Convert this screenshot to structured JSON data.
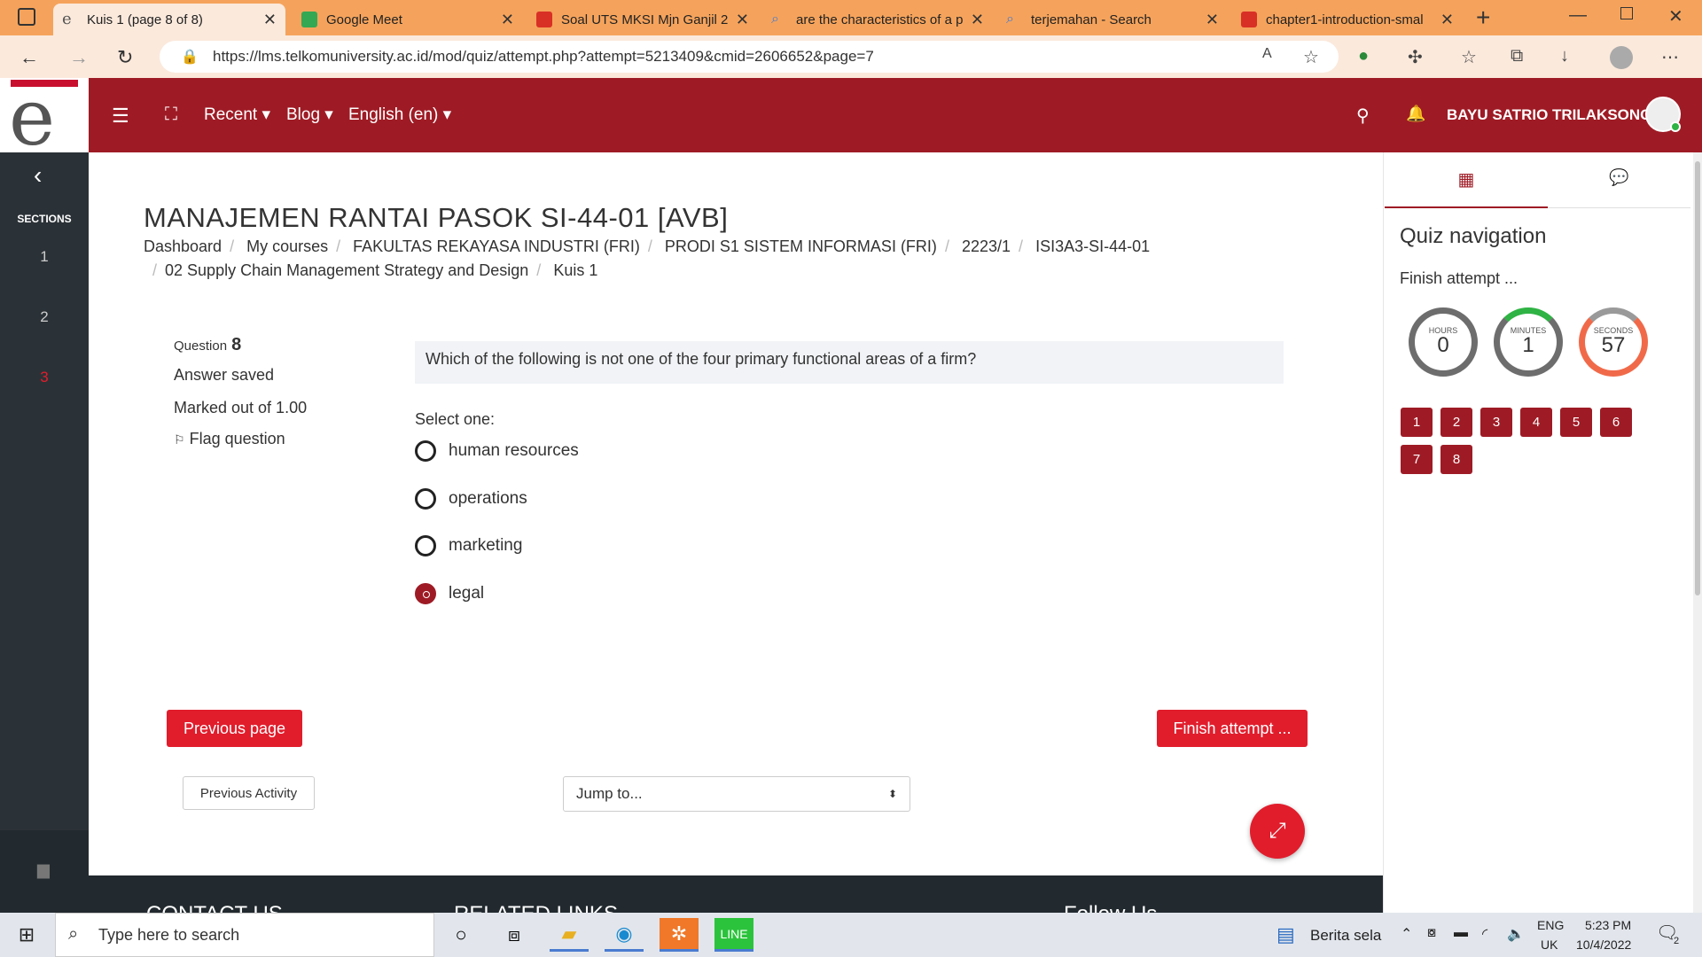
{
  "browser": {
    "tabs": [
      {
        "title": "Kuis 1 (page 8 of 8)",
        "active": true,
        "favicon_color": "#666666"
      },
      {
        "title": "Google Meet",
        "active": false,
        "favicon_color": "#34a853"
      },
      {
        "title": "Soal UTS MKSI Mjn Ganjil 2(",
        "active": false,
        "favicon_color": "#d93025"
      },
      {
        "title": "are the characteristics of a p",
        "active": false,
        "favicon_color": "#4a7bd0"
      },
      {
        "title": "terjemahan - Search",
        "active": false,
        "favicon_color": "#4a7bd0"
      },
      {
        "title": "chapter1-introduction-smal",
        "active": false,
        "favicon_color": "#d93025"
      }
    ],
    "url": "https://lms.telkomuniversity.ac.id/mod/quiz/attempt.php?attempt=5213409&cmid=2606652&page=7"
  },
  "header": {
    "menu_recent": "Recent",
    "menu_blog": "Blog",
    "menu_language": "English (en)",
    "username": "BAYU SATRIO TRILAKSONO",
    "brand_color": "#9e1b25"
  },
  "leftbar": {
    "sections_label": "SECTIONS",
    "items": [
      "1",
      "2",
      "3"
    ]
  },
  "course": {
    "title": "MANAJEMEN RANTAI PASOK SI-44-01 [AVB]",
    "breadcrumb": [
      "Dashboard",
      "My courses",
      "FAKULTAS REKAYASA INDUSTRI (FRI)",
      "PRODI S1 SISTEM INFORMASI (FRI)",
      "2223/1",
      "ISI3A3-SI-44-01",
      "02 Supply Chain Management Strategy and Design",
      "Kuis 1"
    ]
  },
  "question": {
    "label": "Question",
    "number": "8",
    "status": "Answer saved",
    "marks": "Marked out of 1.00",
    "flag": "Flag question",
    "text": "Which of the following is not one of the four primary functional areas of a firm?",
    "select_label": "Select one:",
    "options": [
      {
        "label": "human resources",
        "selected": false
      },
      {
        "label": "operations",
        "selected": false
      },
      {
        "label": "marketing",
        "selected": false
      },
      {
        "label": "legal",
        "selected": true
      }
    ]
  },
  "actions": {
    "previous_page": "Previous page",
    "finish_attempt": "Finish attempt ...",
    "previous_activity": "Previous Activity",
    "jump_to": "Jump to..."
  },
  "footer": {
    "col1": "CONTACT US",
    "col2": "RELATED LINKS",
    "col3": "Follow Us"
  },
  "quiz_nav": {
    "title": "Quiz navigation",
    "finish_link": "Finish attempt ...",
    "timer": {
      "hours_label": "HOURS",
      "hours": "0",
      "minutes_label": "MINUTES",
      "minutes": "1",
      "seconds_label": "SECONDS",
      "seconds": "57"
    },
    "questions": [
      "1",
      "2",
      "3",
      "4",
      "5",
      "6",
      "7",
      "8"
    ]
  },
  "taskbar": {
    "search_placeholder": "Type here to search",
    "news": "Berita sela",
    "lang_top": "ENG",
    "lang_bottom": "UK",
    "time": "5:23 PM",
    "date": "10/4/2022",
    "notif_count": "2"
  }
}
